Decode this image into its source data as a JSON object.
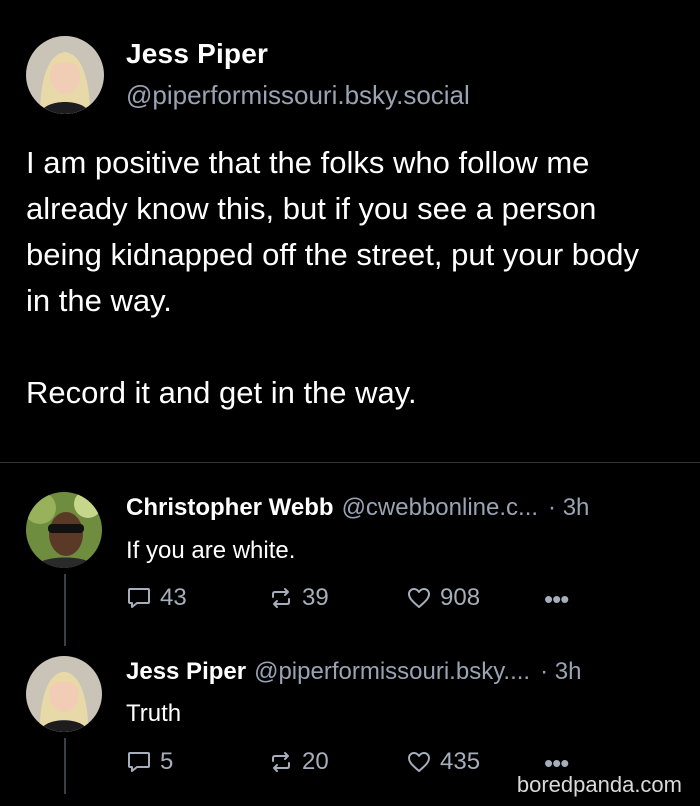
{
  "main_post": {
    "author_name": "Jess Piper",
    "handle": "@piperformissouri.bsky.social",
    "body": "I am positive that the folks who follow me already know this, but if you see a person being kidnapped off the street, put your body in the way.\n\nRecord it and get in the way."
  },
  "replies": [
    {
      "author_name": "Christopher Webb",
      "handle": "@cwebbonline.c...",
      "time": "· 3h",
      "text": "If you are white.",
      "comments": "43",
      "reposts": "39",
      "likes": "908",
      "more": "•••"
    },
    {
      "author_name": "Jess Piper",
      "handle": "@piperformissouri.bsky....",
      "time": "· 3h",
      "text": "Truth",
      "comments": "5",
      "reposts": "20",
      "likes": "435",
      "more": "•••"
    }
  ],
  "watermark": "boredpanda.com",
  "colors": {
    "background": "#000000",
    "text": "#ffffff",
    "muted": "#9aa3b3",
    "divider": "#2f3338"
  },
  "icons": {
    "comment": "speech-bubble-icon",
    "repost": "repost-arrows-icon",
    "like": "heart-icon",
    "more": "ellipsis-icon"
  }
}
